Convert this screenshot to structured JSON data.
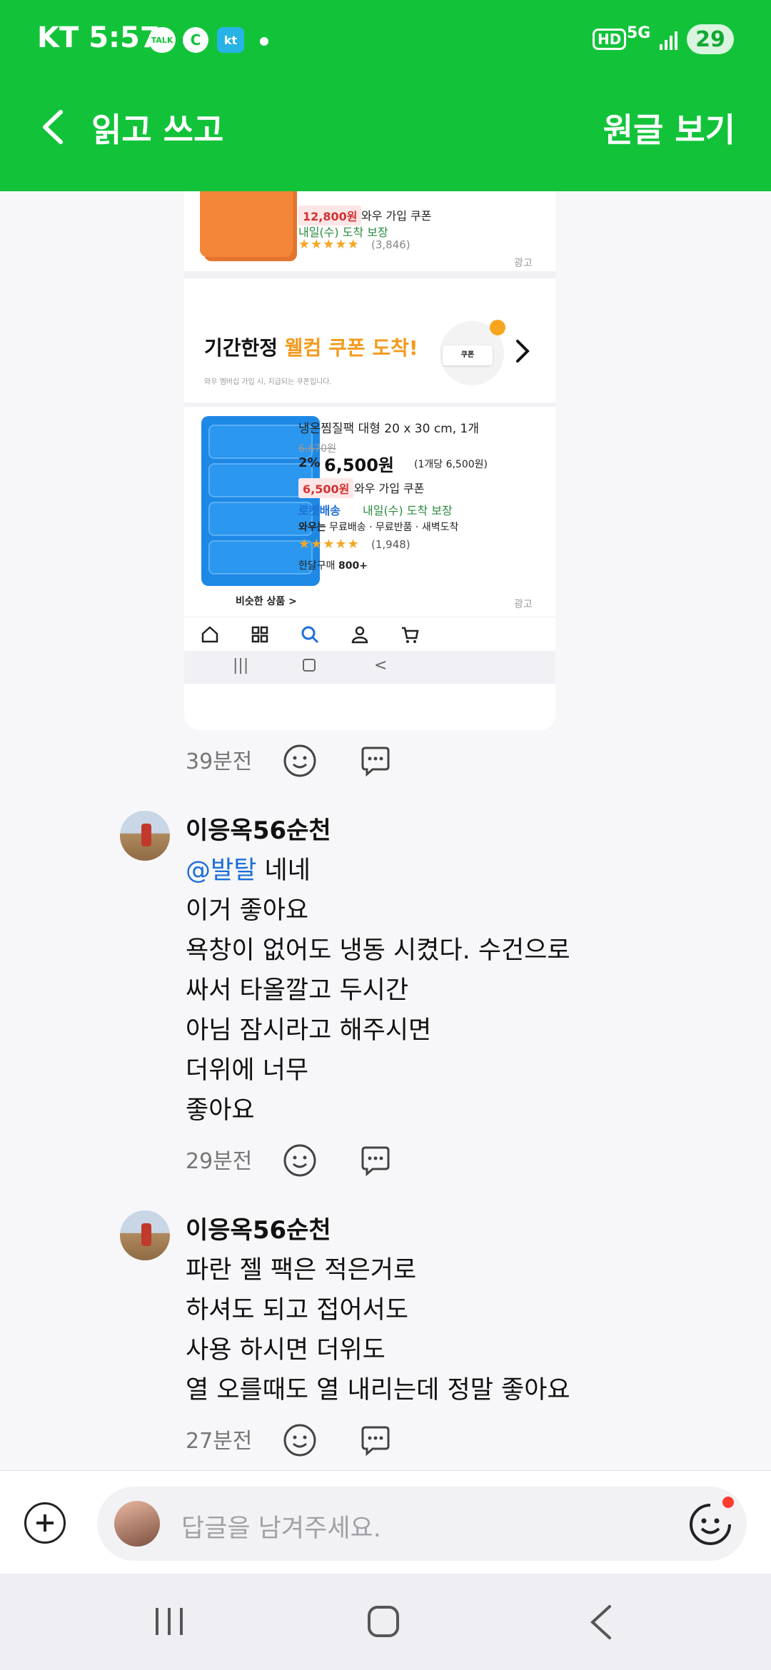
{
  "status_bar": {
    "carrier": "KT",
    "time": "5:57",
    "talk_badge": "TALK",
    "c_badge": "C",
    "kt_badge": "kt",
    "hd_badge": "HD",
    "network": "5G",
    "battery": "29"
  },
  "header": {
    "title": "읽고 쓰고",
    "original_button": "원글 보기"
  },
  "screenshot": {
    "product1": {
      "coupon_price": "12,800원",
      "coupon_label": "와우 가입 쿠폰",
      "delivery": "내일(수) 도착 보장",
      "rating_count": "(3,846)",
      "ad_label": "광고"
    },
    "banner": {
      "title_part1": "기간한정 ",
      "title_accent": "웰컴 쿠폰 도착!",
      "subtitle": "와우 멤버십 가입 시, 지급되는 쿠폰입니다.",
      "coupon_text": "쿠폰"
    },
    "product2": {
      "name": "냉온찜질팩 대형 20 x 30 cm, 1개",
      "original_price": "6,670원",
      "discount": "2%",
      "price": "6,500원",
      "unit_price": "(1개당 6,500원)",
      "coupon_price": "6,500원",
      "coupon_label": "와우 가입 쿠폰",
      "rocket": "로켓배송",
      "delivery": "내일(수) 도착 보장",
      "wow_label": "와우는",
      "wow_benefits": "무료배송 · 무료반품 · 새벽도착",
      "rating_count": "(1,948)",
      "monthly_label": "한달구매",
      "monthly_value": "800+",
      "similar": "비슷한 상품 >",
      "ad_label": "광고"
    }
  },
  "comments": [
    {
      "time": "39분전"
    },
    {
      "author": "이응옥56순천",
      "mention": "@발탈",
      "lines": [
        "네네",
        "이거 좋아요",
        "욕창이 없어도 냉동 시켰다. 수건으로",
        "싸서 타올깔고 두시간",
        "아님 잠시라고 해주시면",
        "더위에 너무",
        "좋아요"
      ],
      "time": "29분전"
    },
    {
      "author": "이응옥56순천",
      "lines": [
        "파란 젤 팩은 적은거로",
        "하셔도 되고 접어서도",
        "사용 하시면 더위도",
        "열 오를때도 열 내리는데 정말 좋아요"
      ],
      "time": "27분전"
    }
  ],
  "reply": {
    "placeholder": "답글을 남겨주세요."
  },
  "colors": {
    "header_green": "#12c33a",
    "mention_blue": "#1d6fd6"
  }
}
